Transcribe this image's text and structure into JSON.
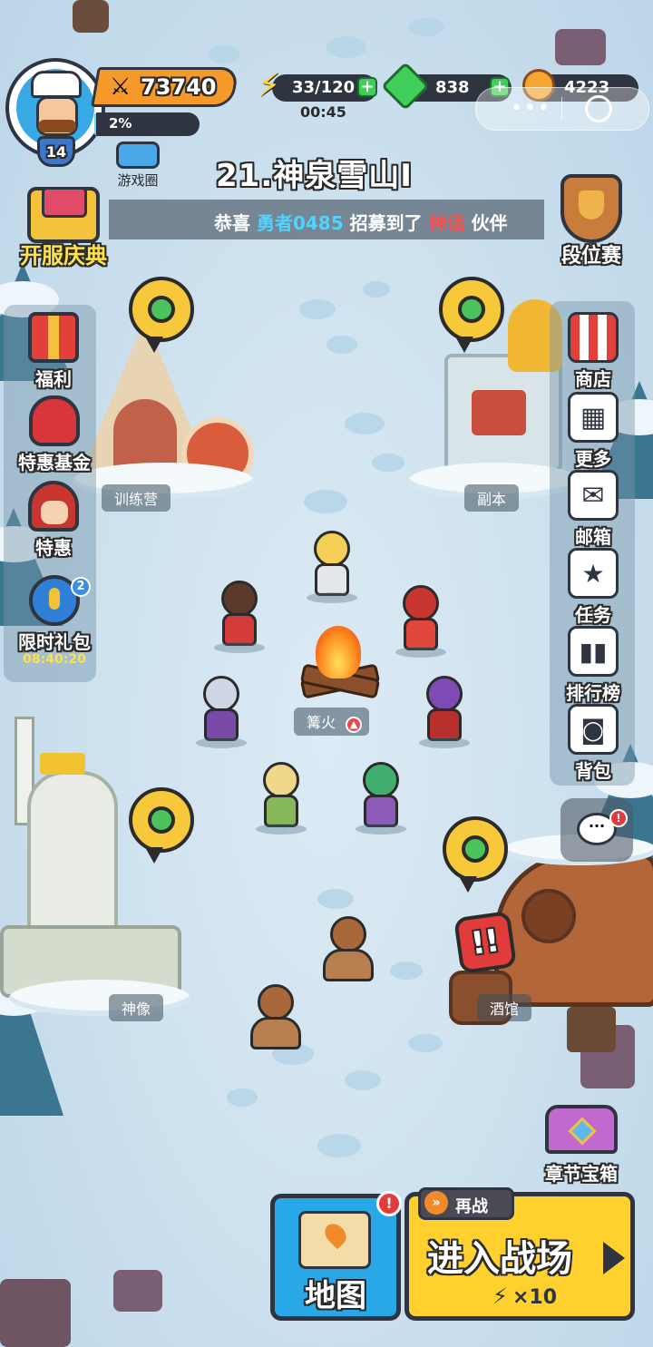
{
  "player": {
    "level": "14",
    "power": "73740",
    "exp_percent_text": "2%",
    "exp_fraction": 0.02
  },
  "resources": {
    "energy": "33/120",
    "energy_timer": "00:45",
    "gems": "838",
    "coins": "4223"
  },
  "stage_title": "21.神泉雪山Ⅰ",
  "community_label": "游戏圈",
  "ticker": {
    "prefix": "恭喜",
    "player_name": "勇者0485",
    "middle": "招募到了",
    "rarity": "神话",
    "suffix": "伙伴"
  },
  "event_label": "开服庆典",
  "ranked_label": "段位赛",
  "left_menu": [
    {
      "label": "福利",
      "icon": "gift-box-icon"
    },
    {
      "label": "特惠基金",
      "icon": "money-bag-icon"
    },
    {
      "label": "特惠",
      "icon": "hooded-girl-icon"
    },
    {
      "label": "限时礼包",
      "icon": "stopwatch-icon",
      "badge": "2",
      "timer": "08:40:20"
    }
  ],
  "right_menu": [
    {
      "label": "商店",
      "icon": "shop-icon"
    },
    {
      "label": "更多",
      "icon": "grid-icon"
    },
    {
      "label": "邮箱",
      "icon": "mail-icon"
    },
    {
      "label": "任务",
      "icon": "task-icon"
    },
    {
      "label": "排行榜",
      "icon": "leaderboard-icon"
    },
    {
      "label": "背包",
      "icon": "backpack-icon"
    }
  ],
  "places": {
    "training_camp": "训练营",
    "dungeon": "副本",
    "campfire": "篝火",
    "statue": "神像",
    "tavern": "酒馆"
  },
  "chapter_chest_label": "章节宝箱",
  "map_button_label": "地图",
  "battle": {
    "retry_label": "再战",
    "enter_label": "进入战场",
    "cost": "×10"
  },
  "colors": {
    "accent_orange": "#f59a2a",
    "energy_yellow": "#ffd23a",
    "gem_green": "#3fcf5a",
    "button_blue": "#29a8e8",
    "button_yellow": "#ffd02e",
    "ticker_cyan": "#4fd3ff",
    "ticker_red": "#ff4b4b"
  }
}
